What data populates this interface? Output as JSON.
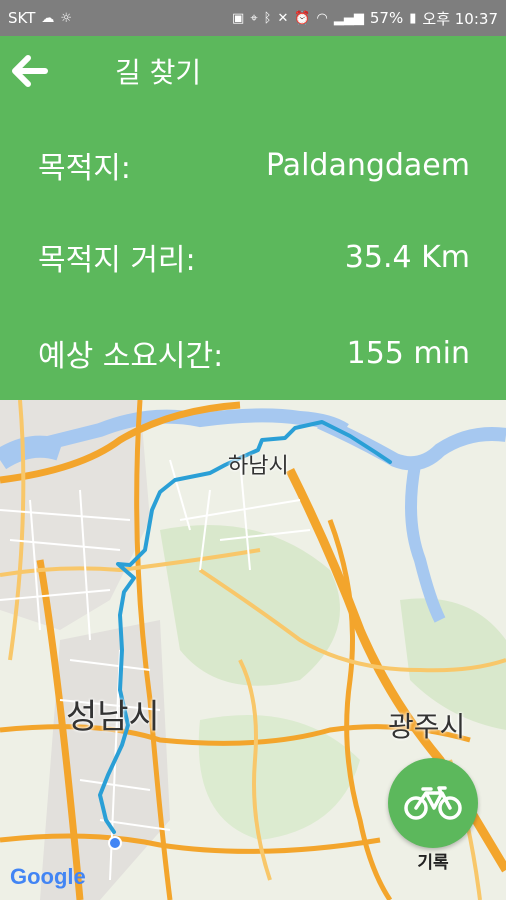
{
  "status_bar": {
    "carrier": "SKT",
    "battery": "57%",
    "time": "오후 10:37"
  },
  "header": {
    "title": "길 찾기",
    "rows": [
      {
        "label": "목적지:",
        "value": "Paldangdaem"
      },
      {
        "label": "목적지 거리:",
        "value": "35.4 Km"
      },
      {
        "label": "예상 소요시간:",
        "value": "155 min"
      }
    ]
  },
  "map": {
    "labels": {
      "hanam": "하남시",
      "seongnam": "성남시",
      "gwangju": "광주시"
    },
    "attribution": "Google",
    "route_color": "#2a9fd6"
  },
  "fab": {
    "icon": "bicycle-icon",
    "label": "기록"
  },
  "colors": {
    "accent": "#5cb85c",
    "status_bar": "#7e7e7e"
  }
}
